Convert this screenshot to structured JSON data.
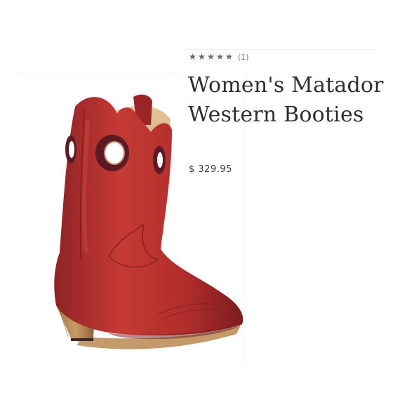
{
  "product": {
    "rating": {
      "stars": [
        "★",
        "★",
        "★",
        "★",
        "★"
      ],
      "score": 5,
      "review_count": "(1)"
    },
    "title": "Women's Matador Western Booties",
    "price": "$ 329.95",
    "image_alt": "Red leather western bootie with snip toe and cut-out circles"
  },
  "colors": {
    "boot_red": "#b32d2b",
    "boot_shadow": "#7d1d1f",
    "heel_wood": "#b98a58",
    "lining_tan": "#d9b98c",
    "star_grey": "#6d6d6d"
  }
}
